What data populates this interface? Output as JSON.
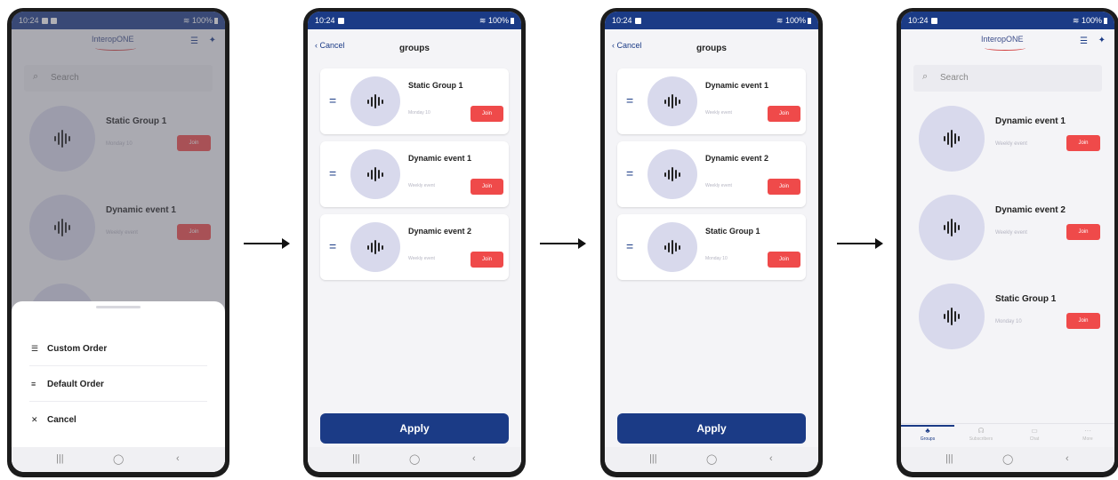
{
  "status": {
    "time": "10:24",
    "battery": "100%"
  },
  "app": {
    "logo_text": "InteropONE"
  },
  "search": {
    "placeholder": "Search"
  },
  "screen1": {
    "items": [
      {
        "title": "Static Group 1",
        "sub": "Monday 10",
        "join": "Join"
      },
      {
        "title": "Dynamic event 1",
        "sub": "Weekly event",
        "join": "Join"
      }
    ],
    "sheet": {
      "custom_order": "Custom Order",
      "default_order": "Default Order",
      "cancel": "Cancel"
    }
  },
  "screen2": {
    "cancel": "Cancel",
    "title": "groups",
    "cards": [
      {
        "title": "Static Group 1",
        "sub": "Monday 10",
        "join": "Join"
      },
      {
        "title": "Dynamic event 1",
        "sub": "Weekly event",
        "join": "Join"
      },
      {
        "title": "Dynamic event 2",
        "sub": "Weekly event",
        "join": "Join"
      }
    ],
    "apply": "Apply"
  },
  "screen3": {
    "cancel": "Cancel",
    "title": "groups",
    "cards": [
      {
        "title": "Dynamic event 1",
        "sub": "Weekly event",
        "join": "Join"
      },
      {
        "title": "Dynamic event 2",
        "sub": "Weekly event",
        "join": "Join"
      },
      {
        "title": "Static Group 1",
        "sub": "Monday 10",
        "join": "Join"
      }
    ],
    "apply": "Apply"
  },
  "screen4": {
    "items": [
      {
        "title": "Dynamic event 1",
        "sub": "Weekly event",
        "join": "Join"
      },
      {
        "title": "Dynamic event 2",
        "sub": "Weekly event",
        "join": "Join"
      },
      {
        "title": "Static Group 1",
        "sub": "Monday 10",
        "join": "Join"
      }
    ],
    "tabs": [
      {
        "label": "Groups",
        "icon": "groups-icon"
      },
      {
        "label": "Subscribers",
        "icon": "subscribers-icon"
      },
      {
        "label": "Chat",
        "icon": "chat-icon"
      },
      {
        "label": "More",
        "icon": "more-icon"
      }
    ]
  },
  "navbar": {
    "recent": "|||",
    "home": "◯",
    "back": "‹"
  },
  "colors": {
    "primary": "#1b3b86",
    "join": "#ef4a4a",
    "avatar": "#d8d9ec"
  }
}
